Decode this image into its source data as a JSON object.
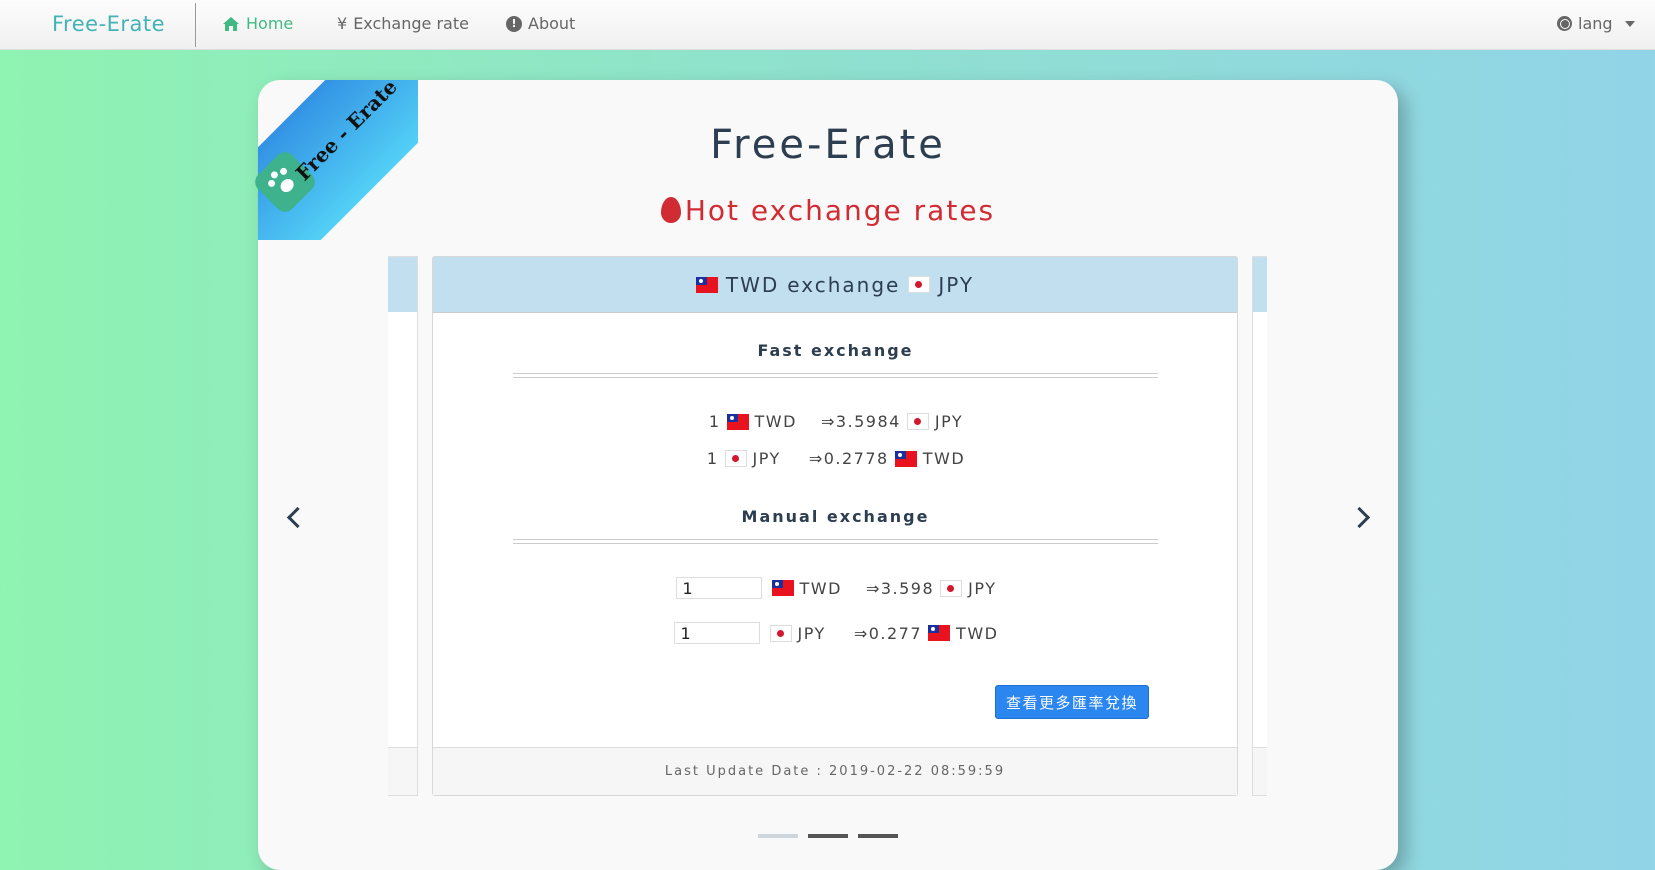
{
  "navbar": {
    "brand": "Free-Erate",
    "home_label": "Home",
    "exchange_label": "Exchange rate",
    "exchange_icon": "¥",
    "about_label": "About",
    "lang_label": "lang"
  },
  "ribbon": {
    "text": "Free - Erate"
  },
  "hero": {
    "title": "Free-Erate",
    "subtitle": "Hot exchange rates"
  },
  "card": {
    "header_from": "TWD",
    "header_word": "exchange",
    "header_to": "JPY",
    "fast_title": "Fast exchange",
    "fast_rows": [
      {
        "amount": "1",
        "from": "TWD",
        "rate": "⇒3.5984",
        "to": "JPY"
      },
      {
        "amount": "1",
        "from": "JPY",
        "rate": "⇒0.2778",
        "to": "TWD"
      }
    ],
    "manual_title": "Manual exchange",
    "manual_rows": [
      {
        "input_value": "1",
        "from": "TWD",
        "rate": "⇒3.598",
        "to": "JPY"
      },
      {
        "input_value": "1",
        "from": "JPY",
        "rate": "⇒0.277",
        "to": "TWD"
      }
    ],
    "more_button": "查看更多匯率兌換",
    "footer": "Last Update Date : 2019-02-22 08:59:59"
  },
  "carousel": {
    "active_slide": 1,
    "total_slides": 3
  }
}
